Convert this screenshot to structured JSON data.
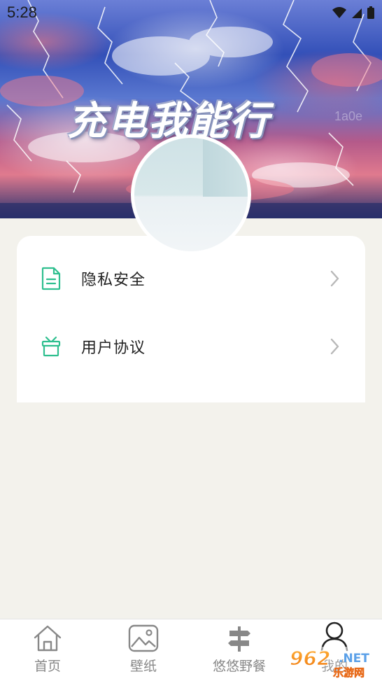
{
  "status_bar": {
    "time": "5:28"
  },
  "hero": {
    "title": "充电我能行",
    "watermark": "1a0e"
  },
  "menu": [
    {
      "label": "隐私安全",
      "icon": "document-icon"
    },
    {
      "label": "用户协议",
      "icon": "gift-box-icon"
    }
  ],
  "bottom_nav": [
    {
      "label": "首页",
      "icon": "home-icon",
      "active": false
    },
    {
      "label": "壁纸",
      "icon": "image-icon",
      "active": false
    },
    {
      "label": "悠悠野餐",
      "icon": "signpost-icon",
      "active": false
    },
    {
      "label": "我的",
      "icon": "user-icon",
      "active": true
    }
  ],
  "watermark_badge": {
    "number": "962",
    "suffix": ".NET",
    "text": "乐游网"
  },
  "colors": {
    "accent": "#2fbf8f",
    "page_bg": "#f3f2ec",
    "card_bg": "#ffffff"
  }
}
